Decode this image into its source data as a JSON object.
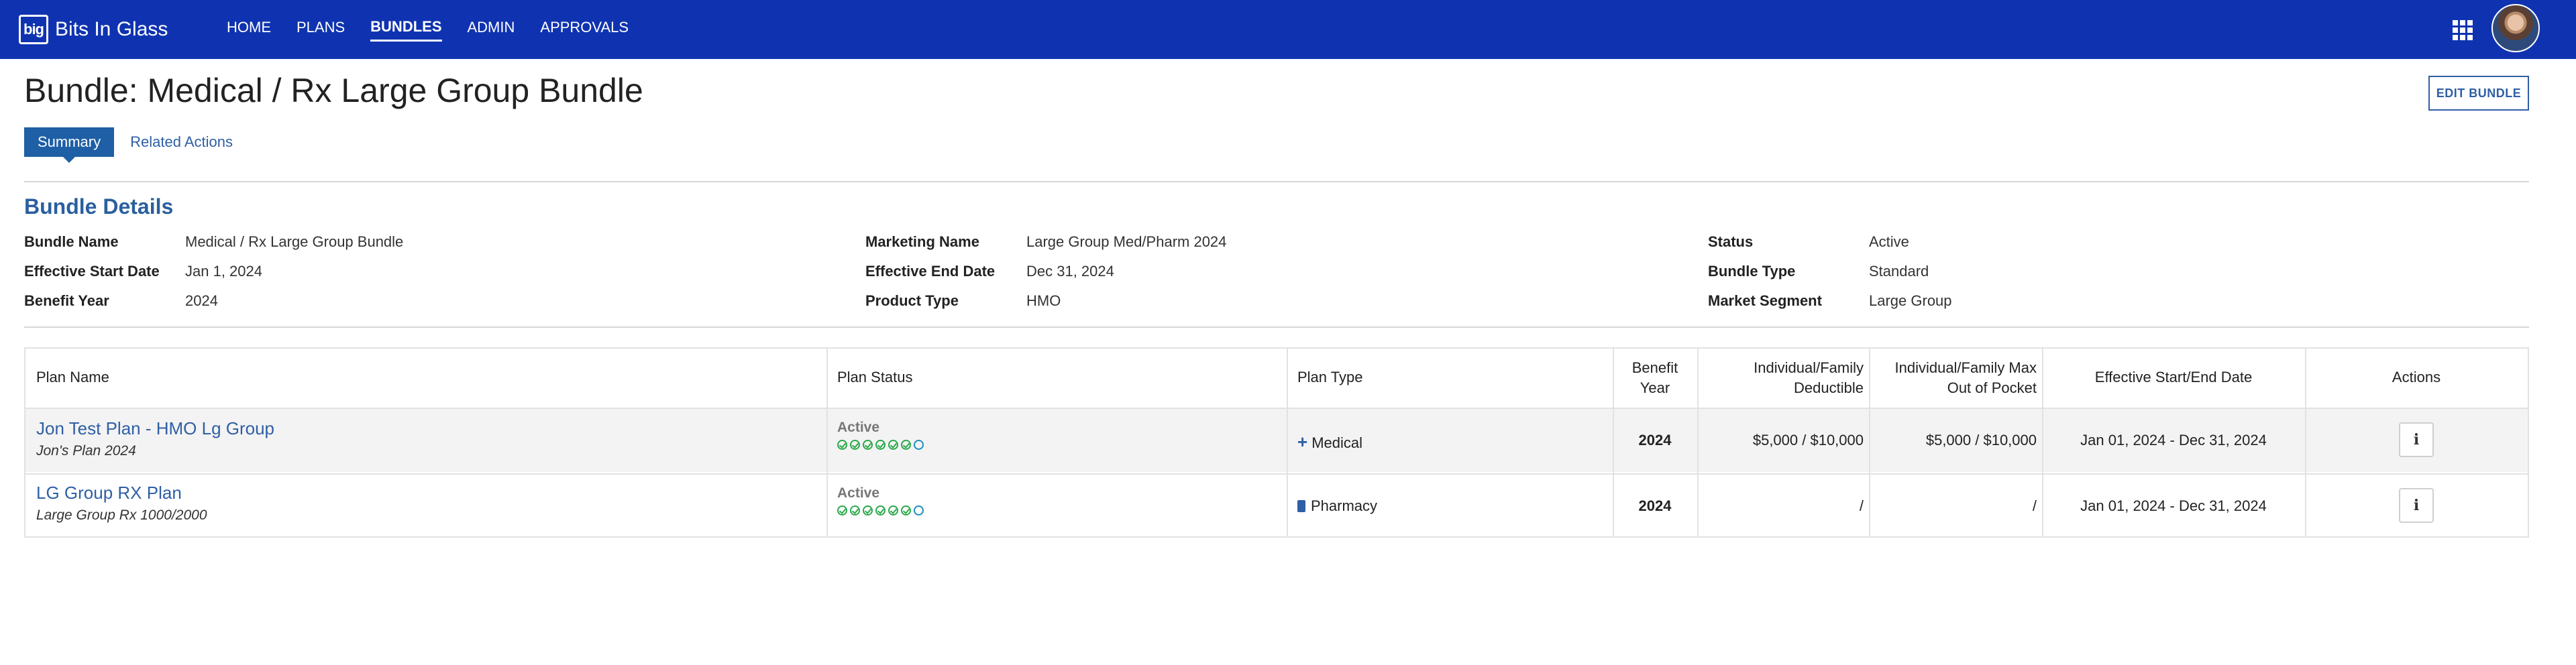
{
  "brand": {
    "logo_text": "big",
    "name": "Bits In Glass"
  },
  "nav": [
    "HOME",
    "PLANS",
    "BUNDLES",
    "ADMIN",
    "APPROVALS"
  ],
  "page": {
    "title": "Bundle: Medical / Rx Large Group Bundle",
    "edit_button": "EDIT BUNDLE",
    "tabs": [
      "Summary",
      "Related Actions"
    ]
  },
  "details": {
    "section_title": "Bundle Details",
    "fields": [
      {
        "label": "Bundle Name",
        "value": "Medical / Rx Large Group Bundle"
      },
      {
        "label": "Effective Start Date",
        "value": "Jan 1, 2024"
      },
      {
        "label": "Benefit Year",
        "value": "2024"
      },
      {
        "label": "Marketing Name",
        "value": "Large Group Med/Pharm 2024"
      },
      {
        "label": "Effective End Date",
        "value": "Dec 31, 2024"
      },
      {
        "label": "Product Type",
        "value": "HMO"
      },
      {
        "label": "Status",
        "value": "Active"
      },
      {
        "label": "Bundle Type",
        "value": "Standard"
      },
      {
        "label": "Market Segment",
        "value": "Large Group"
      }
    ]
  },
  "table": {
    "headers": {
      "plan_name": "Plan Name",
      "plan_status": "Plan Status",
      "plan_type": "Plan Type",
      "benefit_year_1": "Benefit",
      "benefit_year_2": "Year",
      "deductible_1": "Individual/Family",
      "deductible_2": "Deductible",
      "oop_1": "Individual/Family Max",
      "oop_2": "Out of Pocket",
      "dates": "Effective Start/End Date",
      "actions": "Actions"
    },
    "rows": [
      {
        "name": "Jon Test Plan - HMO Lg Group",
        "subtitle": "Jon's Plan 2024",
        "status": "Active",
        "progress_completed": 6,
        "progress_total": 7,
        "type": "Medical",
        "type_icon": "plus-icon",
        "benefit_year": "2024",
        "deductible": "$5,000 / $10,000",
        "oop": "$5,000 / $10,000",
        "dates": "Jan 01, 2024 - Dec 31, 2024",
        "action_icon": "info-icon",
        "action_label": "i"
      },
      {
        "name": "LG Group RX Plan",
        "subtitle": "Large Group Rx 1000/2000",
        "status": "Active",
        "progress_completed": 6,
        "progress_total": 7,
        "type": "Pharmacy",
        "type_icon": "pill-bottle-icon",
        "benefit_year": "2024",
        "deductible": "/",
        "oop": "/",
        "dates": "Jan 01, 2024 - Dec 31, 2024",
        "action_icon": "info-icon",
        "action_label": "i"
      }
    ]
  },
  "colors": {
    "nav_bg": "#0f33b0",
    "accent": "#2f5fa5",
    "tab_active": "#1e5fa6",
    "progress": "#2aa84a"
  }
}
